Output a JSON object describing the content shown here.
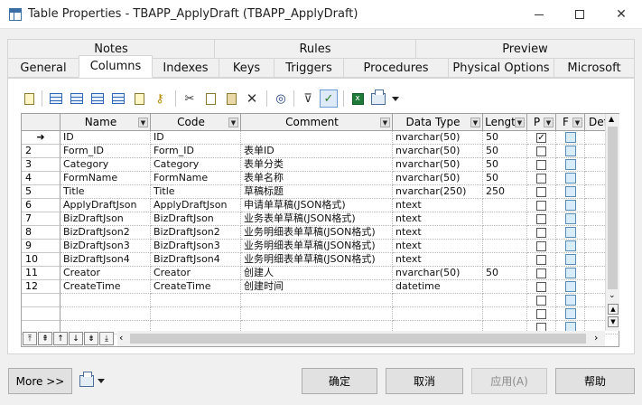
{
  "window": {
    "title": "Table Properties - TBAPP_ApplyDraft (TBAPP_ApplyDraft)"
  },
  "tabs_row1": [
    "Notes",
    "Rules",
    "Preview"
  ],
  "tabs_row2": [
    "General",
    "Columns",
    "Indexes",
    "Keys",
    "Triggers",
    "Procedures",
    "Physical Options",
    "Microsoft"
  ],
  "active_tab": "Columns",
  "grid": {
    "headers": [
      "Name",
      "Code",
      "Comment",
      "Data Type",
      "Lengt",
      "P",
      "F",
      "Def"
    ],
    "rows": [
      {
        "num": "",
        "marker": "➜",
        "name": "ID",
        "code": "ID",
        "comment": "",
        "type": "nvarchar(50)",
        "length": "50",
        "p": true
      },
      {
        "num": "2",
        "marker": "",
        "name": "Form_ID",
        "code": "Form_ID",
        "comment": "表单ID",
        "type": "nvarchar(50)",
        "length": "50",
        "p": false
      },
      {
        "num": "3",
        "marker": "",
        "name": "Category",
        "code": "Category",
        "comment": "表单分类",
        "type": "nvarchar(50)",
        "length": "50",
        "p": false
      },
      {
        "num": "4",
        "marker": "",
        "name": "FormName",
        "code": "FormName",
        "comment": "表单名称",
        "type": "nvarchar(50)",
        "length": "50",
        "p": false
      },
      {
        "num": "5",
        "marker": "",
        "name": "Title",
        "code": "Title",
        "comment": "草稿标题",
        "type": "nvarchar(250)",
        "length": "250",
        "p": false
      },
      {
        "num": "6",
        "marker": "",
        "name": "ApplyDraftJson",
        "code": "ApplyDraftJson",
        "comment": "申请单草稿(JSON格式)",
        "type": "ntext",
        "length": "",
        "p": false
      },
      {
        "num": "7",
        "marker": "",
        "name": "BizDraftJson",
        "code": "BizDraftJson",
        "comment": "业务表单草稿(JSON格式)",
        "type": "ntext",
        "length": "",
        "p": false
      },
      {
        "num": "8",
        "marker": "",
        "name": "BizDraftJson2",
        "code": "BizDraftJson2",
        "comment": "业务明细表单草稿(JSON格式)",
        "type": "ntext",
        "length": "",
        "p": false
      },
      {
        "num": "9",
        "marker": "",
        "name": "BizDraftJson3",
        "code": "BizDraftJson3",
        "comment": "业务明细表单草稿(JSON格式)",
        "type": "ntext",
        "length": "",
        "p": false
      },
      {
        "num": "10",
        "marker": "",
        "name": "BizDraftJson4",
        "code": "BizDraftJson4",
        "comment": "业务明细表单草稿(JSON格式)",
        "type": "ntext",
        "length": "",
        "p": false
      },
      {
        "num": "11",
        "marker": "",
        "name": "Creator",
        "code": "Creator",
        "comment": "创建人",
        "type": "nvarchar(50)",
        "length": "50",
        "p": false
      },
      {
        "num": "12",
        "marker": "",
        "name": "CreateTime",
        "code": "CreateTime",
        "comment": "创建时间",
        "type": "datetime",
        "length": "",
        "p": false
      }
    ],
    "empty_rows": 3
  },
  "buttons": {
    "more": "More >>",
    "ok": "确定",
    "cancel": "取消",
    "apply": "应用(A)",
    "help": "帮助"
  },
  "colors": {
    "accent": "#2f66b3",
    "foreign_box": "#d8ecfa"
  }
}
